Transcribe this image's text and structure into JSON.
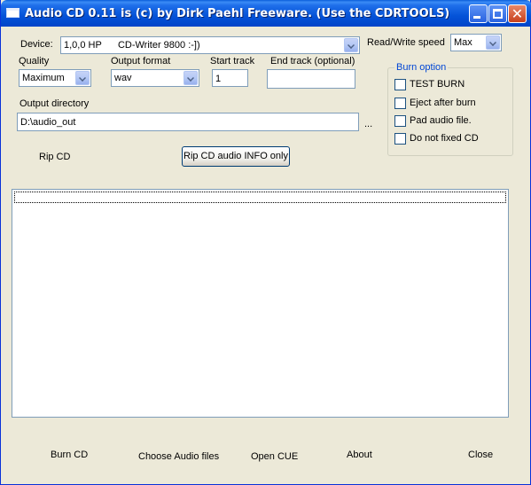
{
  "window": {
    "title": "Audio CD 0.11 is (c) by Dirk Paehl Freeware. (Use the CDRTOOLS)"
  },
  "titlebar_buttons": {
    "minimize_icon": "minimize-icon",
    "maximize_icon": "maximize-icon",
    "close_icon": "close-icon",
    "close_glyph": "✕"
  },
  "device": {
    "label": "Device:",
    "selected": "1,0,0 HP      CD-Writer 9800 :-])"
  },
  "speed": {
    "label": "Read/Write speed",
    "selected": "Max"
  },
  "quality": {
    "label": "Quality",
    "selected": "Maximum"
  },
  "output_format": {
    "label": "Output format",
    "selected": "wav"
  },
  "start_track": {
    "label": "Start track",
    "value": "1"
  },
  "end_track": {
    "label": "End track (optional)",
    "value": ""
  },
  "output_directory": {
    "label": "Output directory",
    "value": "D:\\audio_out",
    "browse_label": "..."
  },
  "burn_option": {
    "legend": "Burn option",
    "options": [
      {
        "label": "TEST BURN",
        "checked": false
      },
      {
        "label": "Eject after burn",
        "checked": false
      },
      {
        "label": "Pad audio file.",
        "checked": false
      },
      {
        "label": "Do not fixed CD",
        "checked": false
      }
    ]
  },
  "actions": {
    "rip_cd": "Rip CD",
    "rip_info": "Rip CD audio INFO only"
  },
  "bottom_buttons": {
    "burn_cd": "Burn CD",
    "choose_audio": "Choose Audio files",
    "open_cue": "Open CUE",
    "about": "About",
    "close": "Close"
  },
  "colors": {
    "titlebar": "#0453D8",
    "window_bg": "#ECE9D8",
    "groupbox_legend": "#0046D5"
  }
}
